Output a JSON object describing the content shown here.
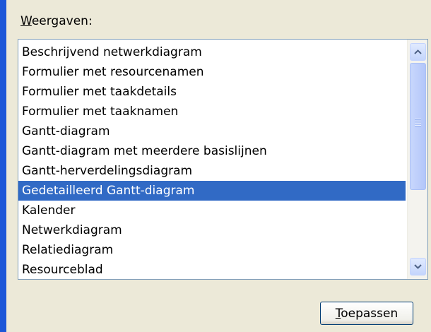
{
  "views_label": "Weergaven:",
  "views_list": {
    "items": [
      "Beschrijvend netwerkdiagram",
      "Formulier met resourcenamen",
      "Formulier met taakdetails",
      "Formulier met taaknamen",
      "Gantt-diagram",
      "Gantt-diagram met meerdere basislijnen",
      "Gantt-herverdelingsdiagram",
      "Gedetailleerd Gantt-diagram",
      "Kalender",
      "Netwerkdiagram",
      "Relatiediagram",
      "Resourceblad"
    ],
    "selected_index": 7
  },
  "scrollbar": {
    "up_icon": "chevron-up-icon",
    "down_icon": "chevron-down-icon",
    "thumb_position": 0
  },
  "apply_button_label": "Toepassen",
  "colors": {
    "accent_strip": "#1c56d8",
    "selection_background": "#316ac5",
    "selection_text": "#ffffff",
    "window_background": "#ece9d8"
  }
}
